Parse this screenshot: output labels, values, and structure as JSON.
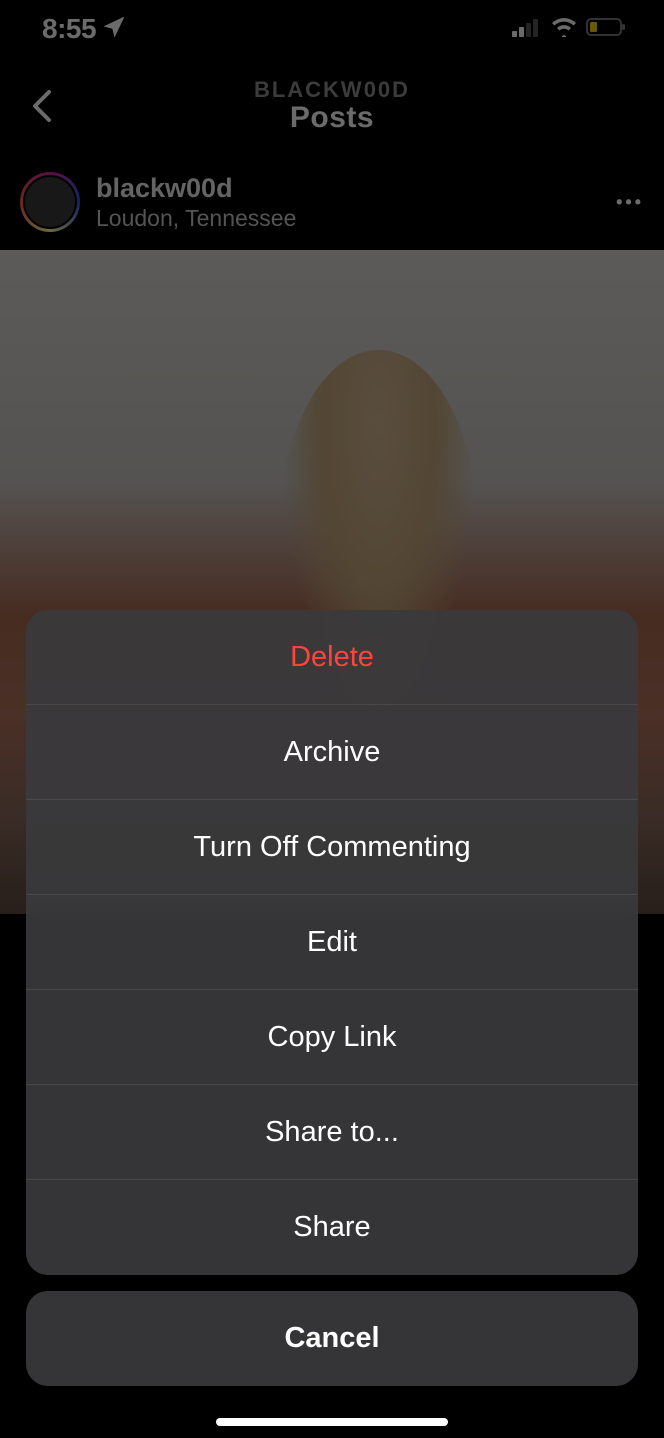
{
  "statusBar": {
    "time": "8:55"
  },
  "nav": {
    "subtitle": "BLACKW00D",
    "title": "Posts"
  },
  "post": {
    "username": "blackw00d",
    "location": "Loudon, Tennessee"
  },
  "actionSheet": {
    "items": [
      {
        "label": "Delete",
        "destructive": true
      },
      {
        "label": "Archive",
        "destructive": false
      },
      {
        "label": "Turn Off Commenting",
        "destructive": false
      },
      {
        "label": "Edit",
        "destructive": false
      },
      {
        "label": "Copy Link",
        "destructive": false
      },
      {
        "label": "Share to...",
        "destructive": false
      },
      {
        "label": "Share",
        "destructive": false
      }
    ],
    "cancel": "Cancel"
  }
}
